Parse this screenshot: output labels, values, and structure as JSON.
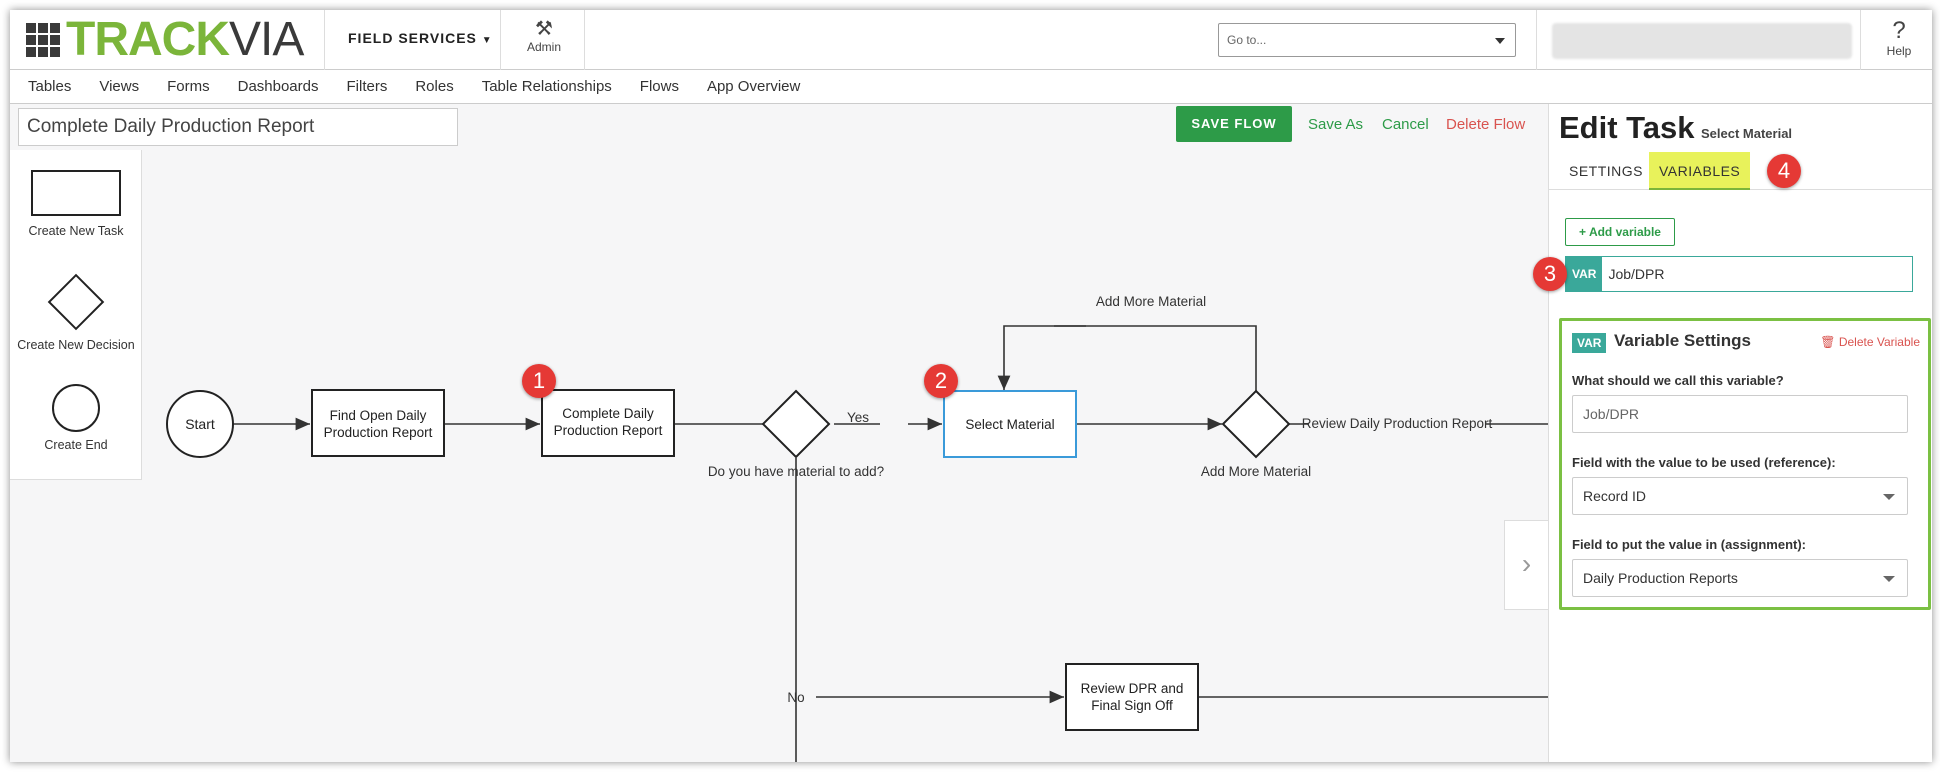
{
  "header": {
    "logo_part1": "TRACK",
    "logo_part2": "VIA",
    "app_name": "FIELD SERVICES",
    "admin_label": "Admin",
    "goto_placeholder": "Go to...",
    "help_label": "Help",
    "admin_icon": "tools-icon",
    "help_icon": "question-icon"
  },
  "nav": [
    "Tables",
    "Views",
    "Forms",
    "Dashboards",
    "Filters",
    "Roles",
    "Table Relationships",
    "Flows",
    "App Overview"
  ],
  "flow": {
    "name": "Complete Daily Production Report",
    "save_label": "SAVE FLOW",
    "save_as_label": "Save As",
    "cancel_label": "Cancel",
    "delete_label": "Delete Flow"
  },
  "palette": {
    "new_task": "Create New Task",
    "new_decision": "Create New Decision",
    "new_end": "Create End"
  },
  "diagram": {
    "start": "Start",
    "task1_line1": "Find Open Daily",
    "task1_line2": "Production Report",
    "task2_line1": "Complete Daily",
    "task2_line2": "Production Report",
    "decision1": "Do you have material to add?",
    "yes": "Yes",
    "no": "No",
    "task3": "Select Material",
    "loop_label": "Add More Material",
    "decision2": "Add More Material",
    "review_label": "Review Daily Production Report",
    "task4_line1": "Review DPR and",
    "task4_line2": "Final Sign Off"
  },
  "callouts": [
    "1",
    "2",
    "3",
    "4"
  ],
  "panel": {
    "title": "Edit Task",
    "subtitle": "Select Material",
    "tab_settings": "SETTINGS",
    "tab_variables": "VARIABLES",
    "add_variable": "Add variable",
    "var_tag": "VAR",
    "var_name": "Job/DPR",
    "settings_title": "Variable Settings",
    "delete_variable": "Delete Variable",
    "q_name": "What should we call this variable?",
    "name_value": "Job/DPR",
    "q_reference": "Field with the value to be used (reference):",
    "reference_value": "Record ID",
    "q_assignment": "Field to put the value in (assignment):",
    "assignment_value": "Daily Production Reports"
  },
  "colors": {
    "brand_green": "#7bb53a",
    "save_green": "#2d9b48",
    "teal": "#3aa89a",
    "delete_red": "#d9534f",
    "highlight_yellow": "#e8f25b",
    "callout_red": "#e53935",
    "selected_task_blue": "#3a9ad9"
  }
}
